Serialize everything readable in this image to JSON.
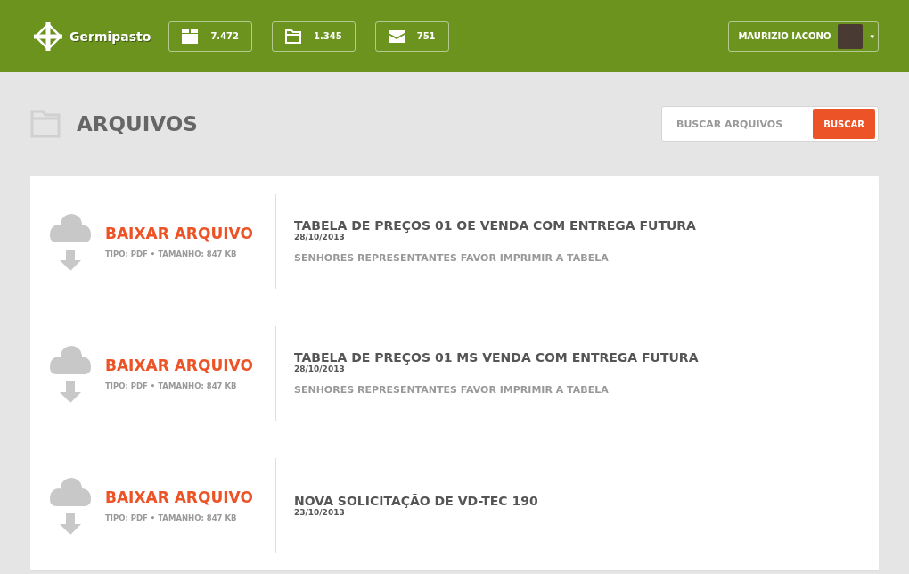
{
  "header": {
    "brand": "Germipasto",
    "counters": [
      {
        "kind": "box",
        "value": "7.472"
      },
      {
        "kind": "folder",
        "value": "1.345"
      },
      {
        "kind": "mail",
        "value": "751"
      }
    ],
    "user": {
      "name": "MAURIZIO IACONO",
      "caret": "▾"
    }
  },
  "page": {
    "title": "ARQUIVOS",
    "search": {
      "placeholder": "BUSCAR ARQUIVOS",
      "button": "BUSCAR"
    }
  },
  "files": [
    {
      "action": "BAIXAR ARQUIVO",
      "meta": "TIPO: PDF • TAMANHO: 847 KB",
      "title": "TABELA DE PREÇOS 01 OE VENDA COM ENTREGA FUTURA",
      "date": "28/10/2013",
      "description": "SENHORES REPRESENTANTES FAVOR IMPRIMIR A TABELA"
    },
    {
      "action": "BAIXAR ARQUIVO",
      "meta": "TIPO: PDF • TAMANHO: 847 KB",
      "title": "TABELA DE PREÇOS 01 MS VENDA COM ENTREGA FUTURA",
      "date": "28/10/2013",
      "description": "SENHORES REPRESENTANTES FAVOR IMPRIMIR A TABELA"
    },
    {
      "action": "BAIXAR ARQUIVO",
      "meta": "TIPO: PDF • TAMANHO: 847 KB",
      "title": "NOVA SOLICITAÇÃO DE VD-TEC 190",
      "date": "23/10/2013"
    }
  ]
}
